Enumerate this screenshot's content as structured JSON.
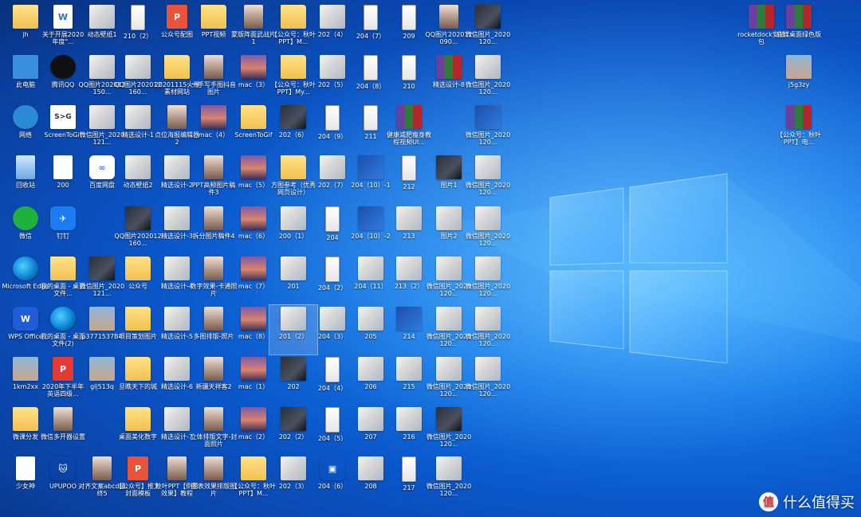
{
  "desktop": {
    "icons": [
      {
        "label": "jh",
        "kind": "user"
      },
      {
        "label": "关于开展2020年度\"...",
        "kind": "doc",
        "glyph": "W"
      },
      {
        "label": "动态壁纸1",
        "kind": "thumb"
      },
      {
        "label": "210（2）",
        "kind": "phone"
      },
      {
        "label": "公众号配图",
        "kind": "ppt",
        "glyph": "P"
      },
      {
        "label": "PPT视频",
        "kind": "folder"
      },
      {
        "label": "蒙版阵面武战片1",
        "kind": "portrait"
      },
      {
        "label": "【公众号：秋叶PPT】M...",
        "kind": "folder"
      },
      {
        "label": "202（4）",
        "kind": "thumb"
      },
      {
        "label": "204（7）",
        "kind": "phone"
      },
      {
        "label": "209",
        "kind": "phone"
      },
      {
        "label": "QQ图片202012090...",
        "kind": "portrait"
      },
      {
        "label": "微信图片_2020120...",
        "kind": "thumbdark"
      },
      {
        "label": "此电脑",
        "kind": "pc"
      },
      {
        "label": "腾讯QQ",
        "kind": "qq"
      },
      {
        "label": "QQ图片202012150...",
        "kind": "thumb"
      },
      {
        "label": "QQ图片202012160...",
        "kind": "thumb"
      },
      {
        "label": "20201115火爆素材网站",
        "kind": "folder"
      },
      {
        "label": "一手写手图抖音图片",
        "kind": "portrait"
      },
      {
        "label": "mac（3）",
        "kind": "mac"
      },
      {
        "label": "【公众号：秋叶PPT】My...",
        "kind": "folder"
      },
      {
        "label": "202（5）",
        "kind": "thumb"
      },
      {
        "label": "204（8）",
        "kind": "phone"
      },
      {
        "label": "210",
        "kind": "phone"
      },
      {
        "label": "精选设计-8",
        "kind": "rar"
      },
      {
        "label": "微信图片_2020120...",
        "kind": "thumb"
      },
      {
        "label": "网络",
        "kind": "net"
      },
      {
        "label": "ScreenToGif",
        "kind": "s2g",
        "glyph": "S>G"
      },
      {
        "label": "微信图片_2020121...",
        "kind": "thumb"
      },
      {
        "label": "精选设计-1",
        "kind": "thumb"
      },
      {
        "label": "点位海报编辑器2",
        "kind": "portrait"
      },
      {
        "label": "mac（4）",
        "kind": "mac"
      },
      {
        "label": "ScreenToGif",
        "kind": "folder"
      },
      {
        "label": "202（6）",
        "kind": "thumbdark"
      },
      {
        "label": "204（9）",
        "kind": "phone"
      },
      {
        "label": "211",
        "kind": "phone"
      },
      {
        "label": "健康减肥瘦身教程视频UI...",
        "kind": "rar"
      },
      {
        "label": "微信图片_2020120...",
        "kind": "bluegrid"
      },
      {
        "label": "回收站",
        "kind": "bin"
      },
      {
        "label": "200",
        "kind": "doc",
        "glyph": ""
      },
      {
        "label": "百度网盘",
        "kind": "baidu",
        "glyph": "∞"
      },
      {
        "label": "动态壁纸2",
        "kind": "thumb"
      },
      {
        "label": "精选设计-2",
        "kind": "thumb"
      },
      {
        "label": "PPT高频图片稿件3",
        "kind": "portrait"
      },
      {
        "label": "mac（5）",
        "kind": "mac"
      },
      {
        "label": "方图参考（优秀网页设计）",
        "kind": "folder"
      },
      {
        "label": "202（7）",
        "kind": "thumb"
      },
      {
        "label": "204（10）-1",
        "kind": "bluegrid"
      },
      {
        "label": "212",
        "kind": "phone"
      },
      {
        "label": "图片1",
        "kind": "thumbdark"
      },
      {
        "label": "微信图片_2020120...",
        "kind": "thumb"
      },
      {
        "label": "微信",
        "kind": "wechat"
      },
      {
        "label": "钉钉",
        "kind": "dingding",
        "glyph": "✈"
      },
      {
        "label": "QQ图片202012160...",
        "kind": "thumbdark"
      },
      {
        "label": "精选设计-3",
        "kind": "thumb"
      },
      {
        "label": "拆分图片稿件4",
        "kind": "portrait"
      },
      {
        "label": "mac（6）",
        "kind": "mac"
      },
      {
        "label": "200（1）",
        "kind": "thumb"
      },
      {
        "label": "204",
        "kind": "phone"
      },
      {
        "label": "204（10）-2",
        "kind": "bluegrid"
      },
      {
        "label": "213",
        "kind": "thumb"
      },
      {
        "label": "图片2",
        "kind": "thumb"
      },
      {
        "label": "微信图片_2020120...",
        "kind": "thumb"
      },
      {
        "label": "Microsoft Edge",
        "kind": "edge"
      },
      {
        "label": "我的桌面 - 桌面文件...",
        "kind": "folder"
      },
      {
        "label": "微信图片_2020121...",
        "kind": "thumbdark"
      },
      {
        "label": "公众号",
        "kind": "folder"
      },
      {
        "label": "精选设计-4",
        "kind": "thumb"
      },
      {
        "label": "数字效果-卡通照片",
        "kind": "portrait"
      },
      {
        "label": "mac（7）",
        "kind": "mac"
      },
      {
        "label": "201",
        "kind": "thumb"
      },
      {
        "label": "204（2）",
        "kind": "phone"
      },
      {
        "label": "204（11）",
        "kind": "thumb"
      },
      {
        "label": "213（2）",
        "kind": "thumb"
      },
      {
        "label": "微信图片_2020120...",
        "kind": "thumb"
      },
      {
        "label": "微信图片_2020120...",
        "kind": "thumb"
      },
      {
        "label": "WPS Office",
        "kind": "wps",
        "glyph": "W"
      },
      {
        "label": "我的桌面 - 桌面文件(2)",
        "kind": "edge"
      },
      {
        "label": "p3771537B4",
        "kind": "photo"
      },
      {
        "label": "项目策划图片",
        "kind": "folder"
      },
      {
        "label": "精选设计-5",
        "kind": "thumb"
      },
      {
        "label": "多图排版-照片",
        "kind": "portrait"
      },
      {
        "label": "mac（8）",
        "kind": "mac"
      },
      {
        "label": "201（2）",
        "kind": "thumb",
        "selected": true
      },
      {
        "label": "204（3）",
        "kind": "thumb"
      },
      {
        "label": "205",
        "kind": "thumb"
      },
      {
        "label": "214",
        "kind": "bluegrid"
      },
      {
        "label": "微信图片_2020120...",
        "kind": "thumb"
      },
      {
        "label": "微信图片_2020120...",
        "kind": "thumb"
      },
      {
        "label": "1km2xx",
        "kind": "photo"
      },
      {
        "label": "2020年下半年英语四级...",
        "kind": "pdf",
        "glyph": "P"
      },
      {
        "label": "glj513q",
        "kind": "photo"
      },
      {
        "label": "旦瞧天下的城",
        "kind": "folder"
      },
      {
        "label": "精选设计-6",
        "kind": "thumb"
      },
      {
        "label": "新疆天祥客2",
        "kind": "portrait"
      },
      {
        "label": "mac（1）",
        "kind": "mac"
      },
      {
        "label": "202",
        "kind": "thumbdark"
      },
      {
        "label": "204（4）",
        "kind": "phone"
      },
      {
        "label": "206",
        "kind": "thumb"
      },
      {
        "label": "215",
        "kind": "thumb"
      },
      {
        "label": "微信图片_2020120...",
        "kind": "thumb"
      },
      {
        "label": "微信图片_2020120...",
        "kind": "thumb"
      },
      {
        "label": "微课分发",
        "kind": "folder"
      },
      {
        "label": "微信多开器设置",
        "kind": "portrait"
      },
      {
        "label": "桌面美化数字",
        "kind": "folder"
      },
      {
        "label": "精选设计-7",
        "kind": "thumb"
      },
      {
        "label": "立体排版文字-封面照片",
        "kind": "portrait"
      },
      {
        "label": "mac（2）",
        "kind": "mac"
      },
      {
        "label": "202（2）",
        "kind": "thumbdark"
      },
      {
        "label": "204（5）",
        "kind": "phone"
      },
      {
        "label": "207",
        "kind": "thumb"
      },
      {
        "label": "216",
        "kind": "thumb"
      },
      {
        "label": "微信图片_2020120...",
        "kind": "thumbdark"
      },
      {
        "label": "少女神",
        "kind": "doc",
        "glyph": ""
      },
      {
        "label": "UPUPOO",
        "kind": "app",
        "glyph": "🐱"
      },
      {
        "label": "对齐文案abcd最终5",
        "kind": "portrait"
      },
      {
        "label": "【公众号】推文封面模板",
        "kind": "ppt",
        "glyph": "P"
      },
      {
        "label": "秋叶PPT【倒影效果】教程",
        "kind": "portrait"
      },
      {
        "label": "图表效果排版图片",
        "kind": "portrait"
      },
      {
        "label": "【公众号：秋叶PPT】M...",
        "kind": "folder"
      },
      {
        "label": "202（3）",
        "kind": "thumb"
      },
      {
        "label": "204（6）",
        "kind": "app",
        "glyph": "▣"
      },
      {
        "label": "208",
        "kind": "thumb"
      },
      {
        "label": "217",
        "kind": "phone"
      },
      {
        "label": "微信图片_2020120...",
        "kind": "thumb"
      },
      {
        "label": "rocketdock安装包",
        "kind": "rar"
      },
      {
        "label": "软媒桌面绿色版",
        "kind": "rar"
      },
      {
        "label": "j5g3zy",
        "kind": "photo"
      },
      {
        "label": "【公众号：秋叶PPT】电...",
        "kind": "rar"
      }
    ]
  },
  "watermark": {
    "badge": "值",
    "text": "什么值得买"
  }
}
